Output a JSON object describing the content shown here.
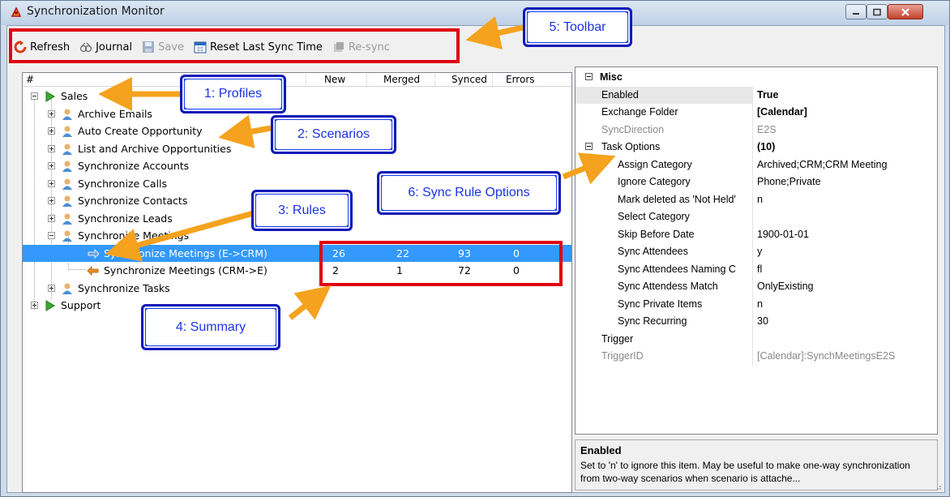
{
  "window": {
    "title": "Synchronization Monitor"
  },
  "toolbar": {
    "refresh": "Refresh",
    "journal": "Journal",
    "save": "Save",
    "reset": "Reset Last Sync Time",
    "resync": "Re-sync"
  },
  "tree": {
    "columns": [
      "#",
      "New",
      "Merged",
      "Synced",
      "Errors"
    ],
    "profiles": [
      "Sales",
      "Support"
    ],
    "scenarios": [
      "Archive Emails",
      "Auto Create Opportunity",
      "List and Archive Opportunities",
      "Synchronize Accounts",
      "Synchronize Calls",
      "Synchronize Contacts",
      "Synchronize Leads",
      "Synchronize Meetings",
      "Synchronize Tasks"
    ],
    "rules": [
      {
        "name": "Synchronize Meetings (E->CRM)",
        "new": "26",
        "merged": "22",
        "synced": "93",
        "errors": "0"
      },
      {
        "name": "Synchronize Meetings (CRM->E)",
        "new": "2",
        "merged": "1",
        "synced": "72",
        "errors": "0"
      }
    ]
  },
  "properties": {
    "misc": {
      "label": "Misc"
    },
    "enabled": {
      "name": "Enabled",
      "value": "True"
    },
    "exchange_folder": {
      "name": "Exchange Folder",
      "value": "[Calendar]"
    },
    "sync_direction": {
      "name": "SyncDirection",
      "value": "E2S"
    },
    "task_options": {
      "name": "Task Options",
      "value": "(10)"
    },
    "options": [
      {
        "name": "Assign Category",
        "value": "Archived;CRM;CRM Meeting"
      },
      {
        "name": "Ignore Category",
        "value": "Phone;Private"
      },
      {
        "name": "Mark deleted as 'Not Held'",
        "value": "n"
      },
      {
        "name": "Select Category",
        "value": ""
      },
      {
        "name": "Skip Before Date",
        "value": "1900-01-01"
      },
      {
        "name": "Sync Attendees",
        "value": "y"
      },
      {
        "name": "Sync Attendees Naming C",
        "value": "fl"
      },
      {
        "name": "Sync Attendess Match",
        "value": "OnlyExisting"
      },
      {
        "name": "Sync Private Items",
        "value": "n"
      },
      {
        "name": "Sync Recurring",
        "value": "30"
      }
    ],
    "trigger": {
      "name": "Trigger",
      "value": ""
    },
    "trigger_id": {
      "name": "TriggerID",
      "value": "[Calendar]:SynchMeetingsE2S"
    }
  },
  "description": {
    "title": "Enabled",
    "text": "Set to 'n' to ignore this item. May be useful to make one-way synchronization from two-way scenarios when scenario is attache..."
  },
  "callouts": {
    "profiles": "1: Profiles",
    "scenarios": "2: Scenarios",
    "rules": "3: Rules",
    "summary": "4: Summary",
    "toolbar": "5: Toolbar",
    "sync_rule_options": "6: Sync Rule Options"
  },
  "colors": {
    "selection": "#3399ff",
    "callout_blue": "#2040f0",
    "highlight_red": "#e00010",
    "arrow_orange": "#f5a21e"
  }
}
